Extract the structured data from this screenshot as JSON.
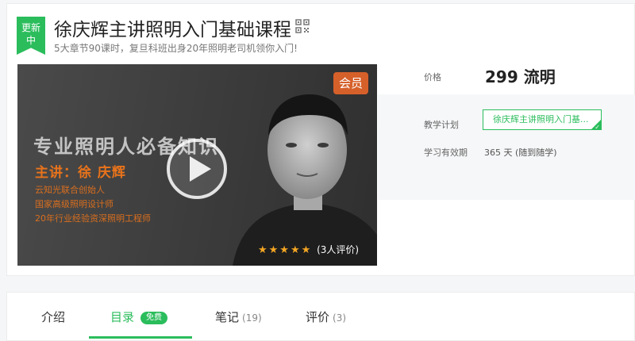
{
  "course": {
    "badge": [
      "更新",
      "中"
    ],
    "title": "徐庆辉主讲照明入门基础课程",
    "subtitle": "5大章节90课时，复旦科班出身20年照明老司机领你入门!"
  },
  "cover": {
    "member_tag": "会员",
    "headline": "专业照明人必备知识",
    "speaker": "主讲：徐 庆辉",
    "lines": [
      "云知光联合创始人",
      "国家高级照明设计师",
      "20年行业经验资深照明工程师"
    ],
    "rating": 5,
    "stars": "★★★★★",
    "review_text": "(3人评价)"
  },
  "pricing": {
    "price_label": "价格",
    "price_value": "299 流明",
    "plan_label": "教学计划",
    "plan_button": "徐庆辉主讲照明入门基...",
    "valid_label": "学习有效期",
    "valid_value": "365 天  (随到随学)"
  },
  "tabs": [
    {
      "label": "介绍",
      "count": ""
    },
    {
      "label": "目录",
      "badge": "免费"
    },
    {
      "label": "笔记",
      "count": "(19)"
    },
    {
      "label": "评价",
      "count": "(3)"
    }
  ],
  "colors": {
    "accent": "#2bbd5c",
    "orange": "#e8731b",
    "member": "#d6602a"
  }
}
